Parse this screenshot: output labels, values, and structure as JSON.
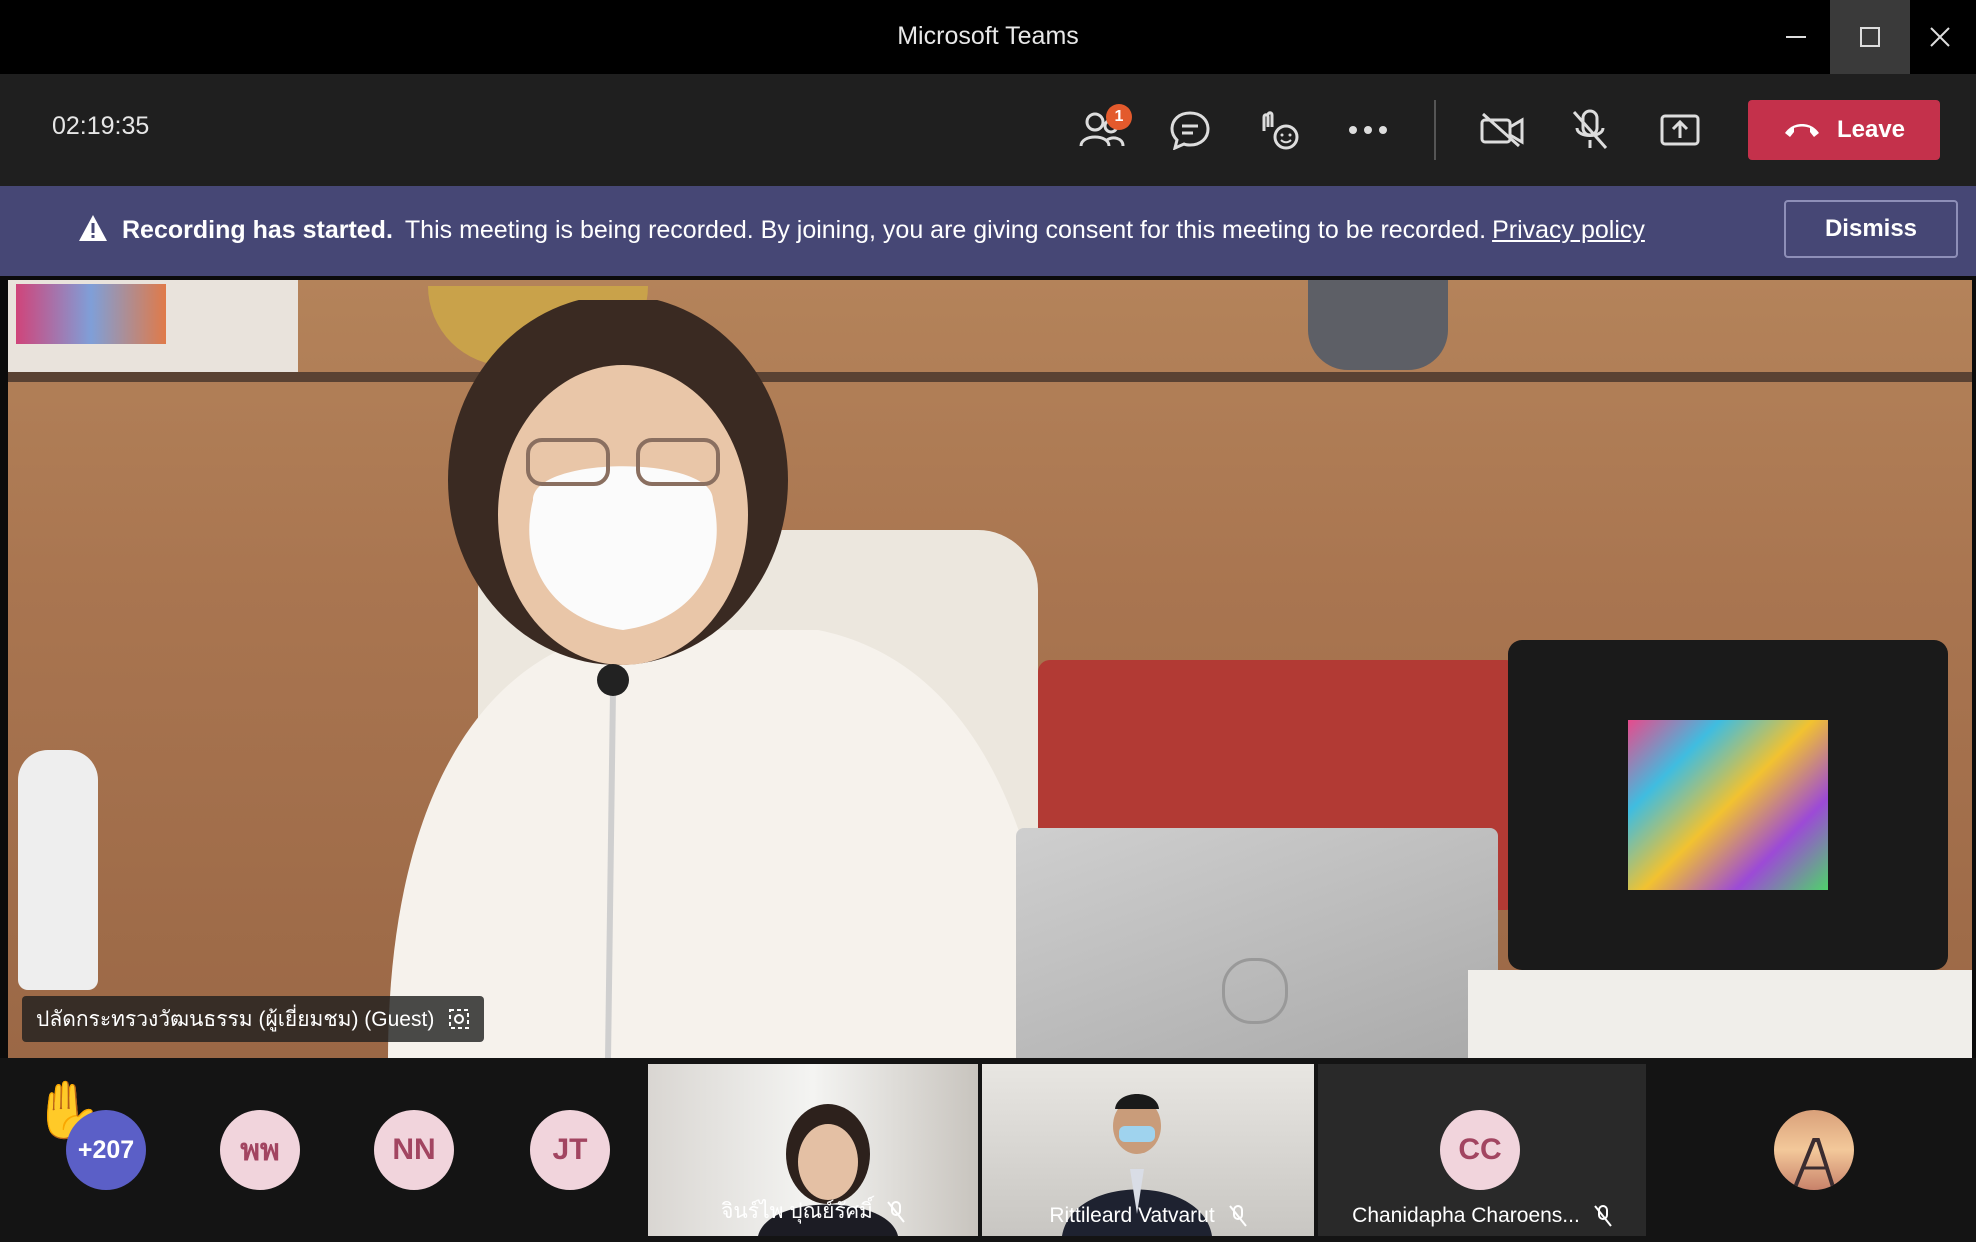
{
  "window": {
    "title": "Microsoft Teams"
  },
  "toolbar": {
    "timer": "02:19:35",
    "participants_badge": "1",
    "leave_label": "Leave"
  },
  "banner": {
    "title": "Recording has started.",
    "message": "This meeting is being recorded. By joining, you are giving consent for this meeting to be recorded.",
    "link": "Privacy policy",
    "dismiss_label": "Dismiss"
  },
  "main_video": {
    "speaker_name": "ปลัดกระทรวงวัฒนธรรม (ผู้เยี่ยมชม) (Guest)"
  },
  "strip": {
    "overflow_count": "+207",
    "avatars": [
      "พพ",
      "NN",
      "JT"
    ],
    "tiles": [
      {
        "name": "จินร์ไพ ปุณย์รัศมิ์"
      },
      {
        "name": "Rittileard Vatvarut"
      },
      {
        "name": "Chanidapha Charoens...",
        "initials": "CC"
      }
    ]
  },
  "colors": {
    "accent": "#464775",
    "leave": "#c4314b",
    "badge": "#e35a2c",
    "overflow": "#5b5fc7",
    "avatar_bg": "#f1d4dc"
  },
  "icons": [
    "minimize-icon",
    "maximize-icon",
    "close-icon",
    "participants-icon",
    "chat-icon",
    "reactions-icon",
    "more-icon",
    "camera-off-icon",
    "mic-off-icon",
    "share-icon",
    "phone-icon",
    "warning-icon",
    "raise-hand-icon",
    "pin-icon"
  ]
}
